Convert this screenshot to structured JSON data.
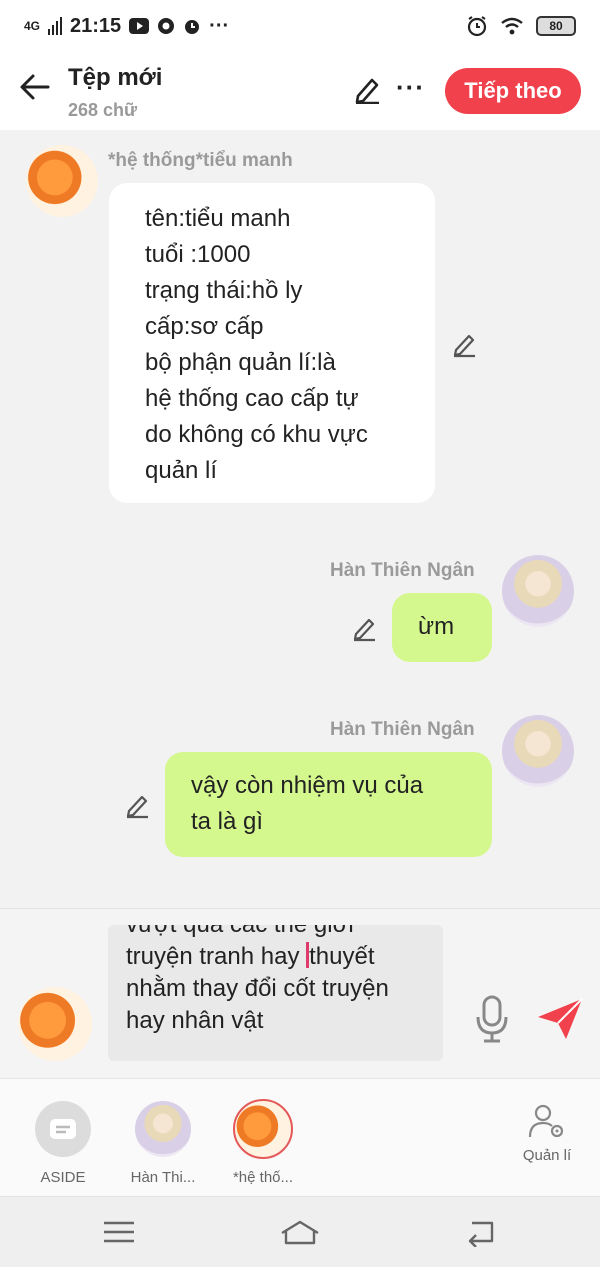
{
  "status_bar": {
    "network": "4G",
    "time": "21:15",
    "dots": "···",
    "battery": "80"
  },
  "header": {
    "title": "Tệp mới",
    "subtitle": "268 chữ",
    "more": "···",
    "next_label": "Tiếp theo"
  },
  "messages": [
    {
      "sender": "*hệ thống*tiểu manh",
      "side": "left",
      "bubble": "white",
      "text": "tên:tiểu manh\ntuổi :1000\ntrạng thái:hồ ly\ncấp:sơ cấp\nbộ phận quản lí:là\nhệ thống cao cấp tự\ndo không có khu vực\nquản lí"
    },
    {
      "sender": "Hàn Thiên Ngân",
      "side": "right",
      "bubble": "green",
      "text": "ừm"
    },
    {
      "sender": "Hàn Thiên Ngân",
      "side": "right",
      "bubble": "green",
      "text": "vậy còn nhiệm vụ của\nta là gì"
    }
  ],
  "composer": {
    "text_before_caret": "vượt qua các thế giới\ntruyện tranh hay ",
    "text_after_caret": "thuyết\nnhằm thay đổi cốt truyện\nhay nhân vật"
  },
  "roles": [
    {
      "label": "ASIDE"
    },
    {
      "label": "Hàn Thi..."
    },
    {
      "label": "*hệ thố..."
    },
    {
      "label": "Quản lí"
    }
  ],
  "colors": {
    "accent": "#f0414c",
    "green_bubble": "#d4f78e"
  }
}
